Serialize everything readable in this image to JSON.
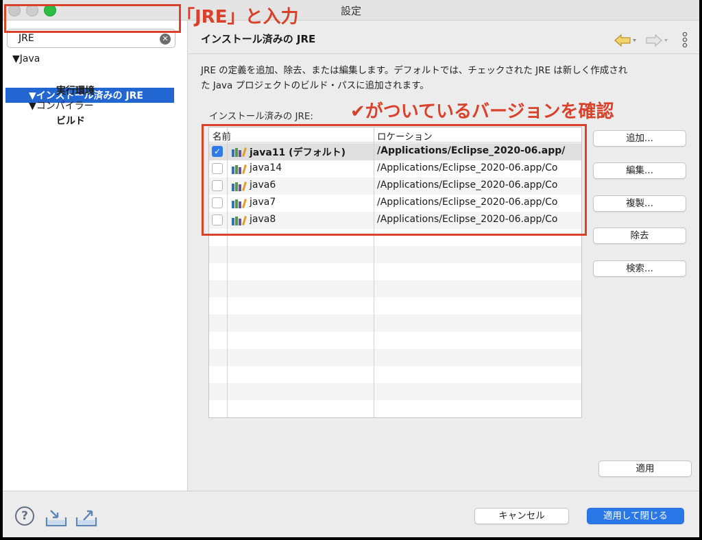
{
  "window": {
    "title": "設定"
  },
  "annotations": {
    "search_note": "「JRE」と入力",
    "check_note": "✔がついているバージョンを確認"
  },
  "sidebar": {
    "search_value": "JRE",
    "tree": [
      {
        "label": "▼Java"
      },
      {
        "label": "▼インストール済みの JRE"
      },
      {
        "label": "実行環境"
      },
      {
        "label": "▼コンパイラー"
      },
      {
        "label": "ビルド"
      }
    ]
  },
  "main": {
    "title": "インストール済みの JRE",
    "description_line1": "JRE の定義を追加、除去、または編集します。デフォルトでは、チェックされた JRE は新しく作成され",
    "description_line2": "た Java プロジェクトのビルド・パスに追加されます。",
    "jre_label": "インストール済みの JRE:",
    "table": {
      "col_name": "名前",
      "col_location": "ロケーション",
      "rows": [
        {
          "name": "java11 (デフォルト)",
          "location": "/Applications/Eclipse_2020-06.app/",
          "checked": true
        },
        {
          "name": "java14",
          "location": "/Applications/Eclipse_2020-06.app/Co",
          "checked": false
        },
        {
          "name": "java6",
          "location": "/Applications/Eclipse_2020-06.app/Co",
          "checked": false
        },
        {
          "name": "java7",
          "location": "/Applications/Eclipse_2020-06.app/Co",
          "checked": false
        },
        {
          "name": "java8",
          "location": "/Applications/Eclipse_2020-06.app/Co",
          "checked": false
        }
      ]
    },
    "buttons": {
      "add": "追加...",
      "edit": "編集...",
      "duplicate": "複製...",
      "remove": "除去",
      "search": "検索...",
      "apply": "適用"
    }
  },
  "footer": {
    "cancel": "キャンセル",
    "apply_close": "適用して閉じる"
  },
  "colors": {
    "accent": "#2a78e8",
    "selection": "#2166d1",
    "annotation": "#d9412b"
  }
}
